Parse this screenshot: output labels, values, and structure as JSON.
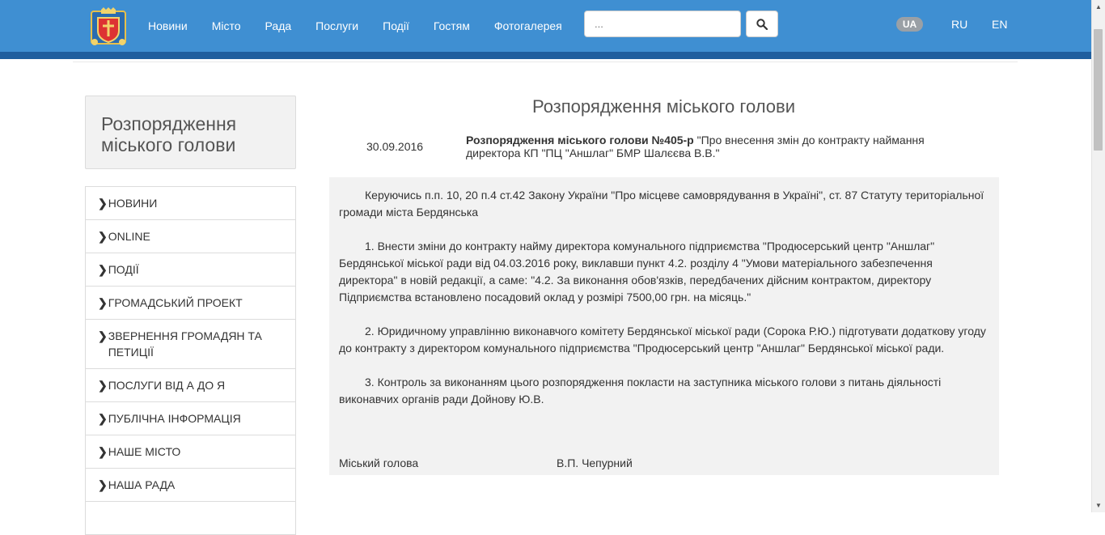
{
  "nav": {
    "items": [
      "Новини",
      "Місто",
      "Рада",
      "Послуги",
      "Події",
      "Гостям",
      "Фотогалерея"
    ],
    "search_placeholder": "...",
    "languages": {
      "active": "UA",
      "ru": "RU",
      "en": "EN"
    }
  },
  "sidebar": {
    "title": "Розпорядження міського голови",
    "items": [
      {
        "label": "Новини"
      },
      {
        "label": "Online"
      },
      {
        "label": "Події"
      },
      {
        "label": "Громадський проект"
      },
      {
        "label": "Звернення громадян та петиції"
      },
      {
        "label": "Послуги від А до Я"
      },
      {
        "label": "Публічна інформація"
      },
      {
        "label": "Наше місто"
      },
      {
        "label": "Наша рада"
      }
    ]
  },
  "main": {
    "page_title": "Розпорядження міського голови",
    "doc_date": "30.09.2016",
    "doc_number": "Розпорядження міського голови №405-р",
    "doc_subject": " \"Про внесення змін до контракту наймання директора КП \"ПЦ \"Аншлаг\" БМР Шалєєва В.В.\"",
    "paragraphs": [
      "Керуючись п.п. 10, 20 п.4 ст.42 Закону України \"Про місцеве самоврядування в Україні\", ст. 87 Статуту територіальної громади міста Бердянська",
      "1. Внести зміни до контракту найму директора комунального підприємства \"Продюсерський центр \"Аншлаг\" Бердянської міської ради від 04.03.2016 року, виклавши пункт 4.2. розділу 4 \"Умови матеріального забезпечення директора\" в новій редакції, а саме: \"4.2. За виконання обов'язків, передбачених дійсним контрактом, директору Підприємства встановлено посадовий оклад у розмірі 7500,00 грн. на місяць.\"",
      "2. Юридичному управлінню виконавчого комітету Бердянської міської ради (Сорока Р.Ю.) підготувати додаткову угоду до контракту з директором комунального підприємства \"Продюсерський центр \"Аншлаг\" Бердянської міської ради.",
      "3. Контроль за виконанням цього розпорядження покласти на заступника міського голови з питань діяльності виконавчих органів ради Дойнову Ю.В."
    ],
    "signature_role": "Міський голова",
    "signature_name": "В.П. Чепурний"
  },
  "colors": {
    "navbar": "#3f8fd2",
    "navbar_stripe": "#1f5e9e",
    "content_bg": "#f2f2f2"
  }
}
